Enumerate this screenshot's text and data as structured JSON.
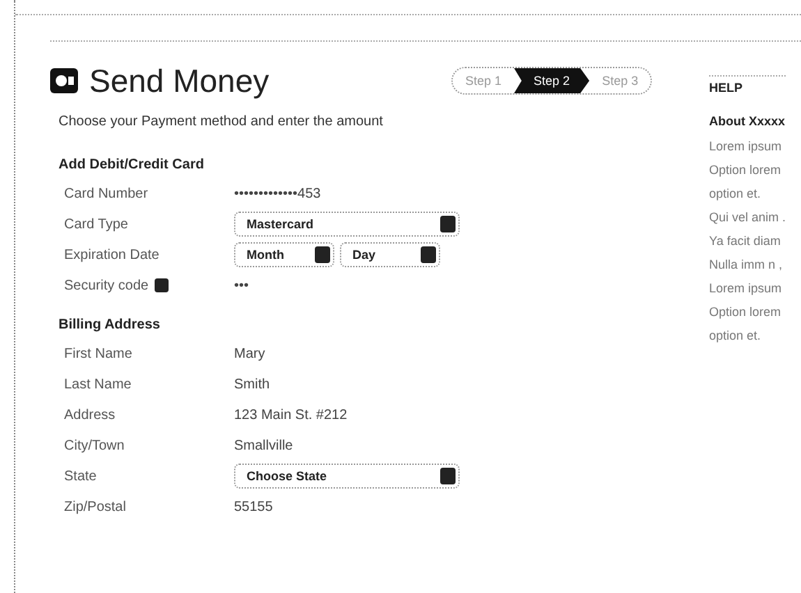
{
  "header": {
    "title": "Send Money",
    "steps": [
      {
        "label": "Step 1",
        "selected": false
      },
      {
        "label": "Step 2",
        "selected": true
      },
      {
        "label": "Step 3",
        "selected": false
      }
    ],
    "subtitle": "Choose your Payment method and enter the amount"
  },
  "card_section": {
    "heading": "Add Debit/Credit Card",
    "rows": [
      {
        "label": "Card Number",
        "kind": "text",
        "value": "•••••••••••••453"
      },
      {
        "label": "Card Type",
        "kind": "select",
        "value": "Mastercard"
      },
      {
        "label": "Expiration Date",
        "kind": "pair",
        "selects": [
          "Month",
          "Day"
        ]
      },
      {
        "label": "Security code",
        "kind": "text",
        "help": true,
        "value": "•••"
      }
    ]
  },
  "billing_section": {
    "heading": "Billing Address",
    "rows": [
      {
        "label": "First Name",
        "kind": "text",
        "value": "Mary"
      },
      {
        "label": "Last Name",
        "kind": "text",
        "value": "Smith"
      },
      {
        "label": "Address",
        "kind": "text",
        "value": "123 Main St. #212"
      },
      {
        "label": "City/Town",
        "kind": "text",
        "value": "Smallville"
      },
      {
        "label": "State",
        "kind": "select",
        "value": "Choose State"
      },
      {
        "label": "Zip/Postal",
        "kind": "text",
        "value": "55155"
      }
    ]
  },
  "help_panel": {
    "title": "HELP",
    "heading": "About Xxxxx",
    "lines": [
      "Lorem ipsum",
      "Option lorem",
      "option et.",
      "Qui vel anim .",
      "Ya facit diam",
      "Nulla imm n ,",
      "Lorem ipsum",
      "Option lorem",
      "option et."
    ]
  }
}
